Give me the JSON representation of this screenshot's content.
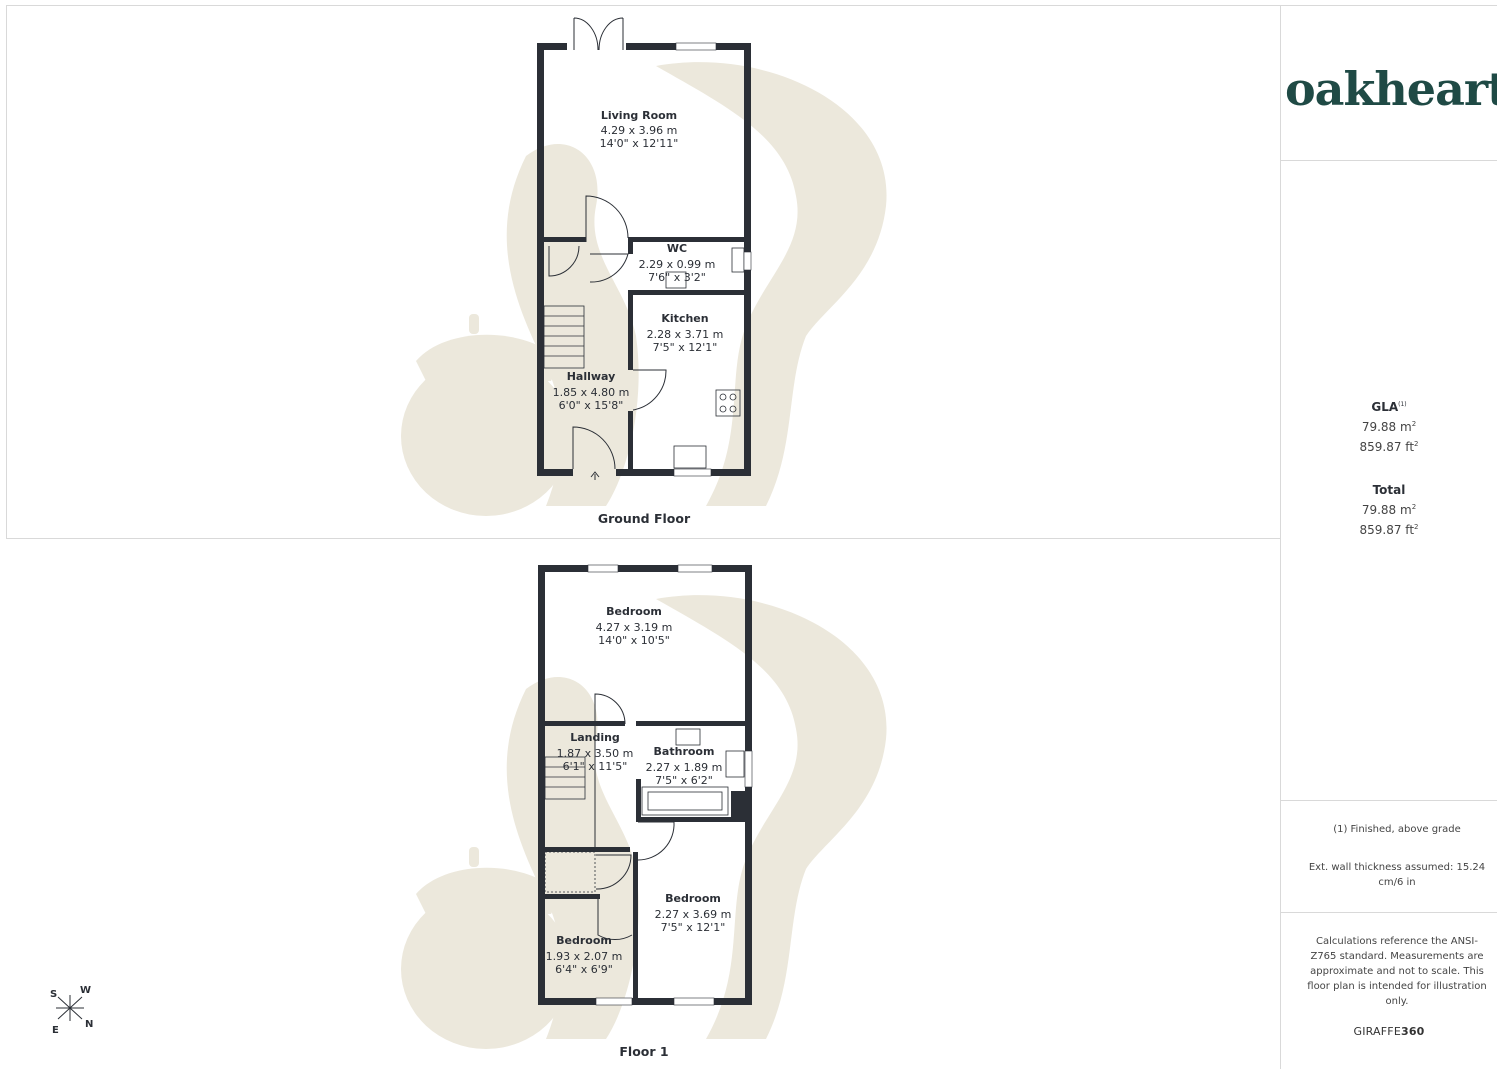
{
  "brand_logo": "oakheart",
  "ground_floor": {
    "title": "Ground Floor",
    "rooms": [
      {
        "name": "Living Room",
        "metric": "4.29 x 3.96 m",
        "imperial": "14'0\" x 12'11\""
      },
      {
        "name": "WC",
        "metric": "2.29 x 0.99 m",
        "imperial": "7'6\" x 3'2\""
      },
      {
        "name": "Kitchen",
        "metric": "2.28 x 3.71 m",
        "imperial": "7'5\" x 12'1\""
      },
      {
        "name": "Hallway",
        "metric": "1.85 x 4.80 m",
        "imperial": "6'0\" x 15'8\""
      }
    ]
  },
  "floor_1": {
    "title": "Floor 1",
    "rooms": [
      {
        "name": "Bedroom",
        "metric": "4.27 x 3.19 m",
        "imperial": "14'0\" x 10'5\""
      },
      {
        "name": "Landing",
        "metric": "1.87 x 3.50 m",
        "imperial": "6'1\" x 11'5\""
      },
      {
        "name": "Bathroom",
        "metric": "2.27 x 1.89 m",
        "imperial": "7'5\" x 6'2\""
      },
      {
        "name": "Bedroom",
        "metric": "2.27 x 3.69 m",
        "imperial": "7'5\" x 12'1\""
      },
      {
        "name": "Bedroom",
        "metric": "1.93 x 2.07 m",
        "imperial": "6'4\" x 6'9\""
      }
    ]
  },
  "compass": {
    "s": "S",
    "w": "W",
    "e": "E",
    "n": "N"
  },
  "summary": {
    "gla_label": "GLA",
    "gla_note_ref": "(1)",
    "gla_m2": "79.88 m",
    "gla_ft2": "859.87 ft",
    "total_label": "Total",
    "total_m2": "79.88 m",
    "total_ft2": "859.87 ft",
    "sq": "2"
  },
  "notes": {
    "finished": "(1) Finished, above grade",
    "wall": "Ext. wall thickness assumed: 15.24 cm/6 in",
    "calc": "Calculations reference the ANSI-Z765 standard. Measurements are approximate and not to scale. This floor plan is intended for illustration only."
  },
  "credit": {
    "prefix": "GIRAFFE",
    "suffix": "360"
  },
  "colors": {
    "wall": "#2b2f36",
    "watermark": "#ece8dc",
    "brand": "#1f4a45"
  }
}
